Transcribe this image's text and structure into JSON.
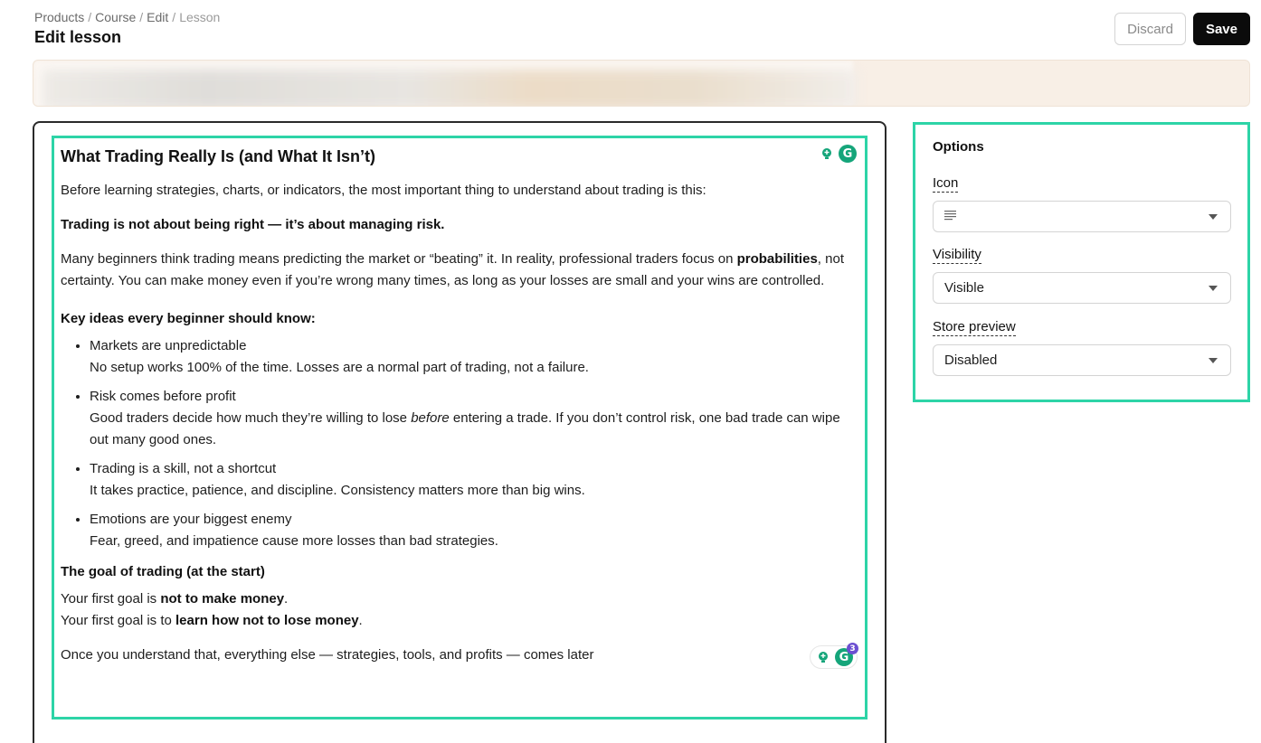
{
  "breadcrumb": {
    "items": [
      "Products",
      "Course",
      "Edit"
    ],
    "current": "Lesson",
    "separator": "/"
  },
  "page_title": "Edit lesson",
  "actions": {
    "discard": "Discard",
    "save": "Save"
  },
  "editor": {
    "title": "What Trading Really Is (and What It Isn’t)",
    "intro": "Before learning strategies, charts, or indicators, the most important thing to understand about trading is this:",
    "key_statement": "Trading is not about being right — it’s about managing risk.",
    "para1_a": "Many beginners think trading means predicting the market or “beating” it. In reality, professional traders focus on ",
    "para1_bold": "probabilities",
    "para1_b": ", not certainty. You can make money even if you’re wrong many times, as long as your losses are small and your wins are controlled.",
    "key_ideas_heading": "Key ideas every beginner should know:",
    "list": [
      {
        "title": "Markets are unpredictable",
        "body_a": "No setup works 100% of the time. Losses are a normal part of trading, not a failure.",
        "body_italic": "",
        "body_b": ""
      },
      {
        "title": "Risk comes before profit",
        "body_a": "Good traders decide how much they’re willing to lose ",
        "body_italic": "before",
        "body_b": " entering a trade. If you don’t control risk, one bad trade can wipe out many good ones."
      },
      {
        "title": "Trading is a skill, not a shortcut",
        "body_a": "It takes practice, patience, and discipline. Consistency matters more than big wins.",
        "body_italic": "",
        "body_b": ""
      },
      {
        "title": "Emotions are your biggest enemy",
        "body_a": "Fear, greed, and impatience cause more losses than bad strategies.",
        "body_italic": "",
        "body_b": ""
      }
    ],
    "goal_heading": "The goal of trading (at the start)",
    "goal_line1_a": "Your first goal is ",
    "goal_line1_b": "not to make money",
    "goal_line1_c": ".",
    "goal_line2_a": "Your first goal is to ",
    "goal_line2_b": "learn how not to lose money",
    "goal_line2_c": ".",
    "closing": "Once you understand that, everything else — strategies, tools, and profits — comes later",
    "grammarly_count": "3"
  },
  "options": {
    "title": "Options",
    "icon_label": "Icon",
    "icon_value_icon": "text-lines-icon",
    "visibility_label": "Visibility",
    "visibility_value": "Visible",
    "store_preview_label": "Store preview",
    "store_preview_value": "Disabled"
  },
  "colors": {
    "highlight": "#2dd4a7",
    "save_bg": "#0b0b0b",
    "notice_bg": "#f8efe6"
  }
}
